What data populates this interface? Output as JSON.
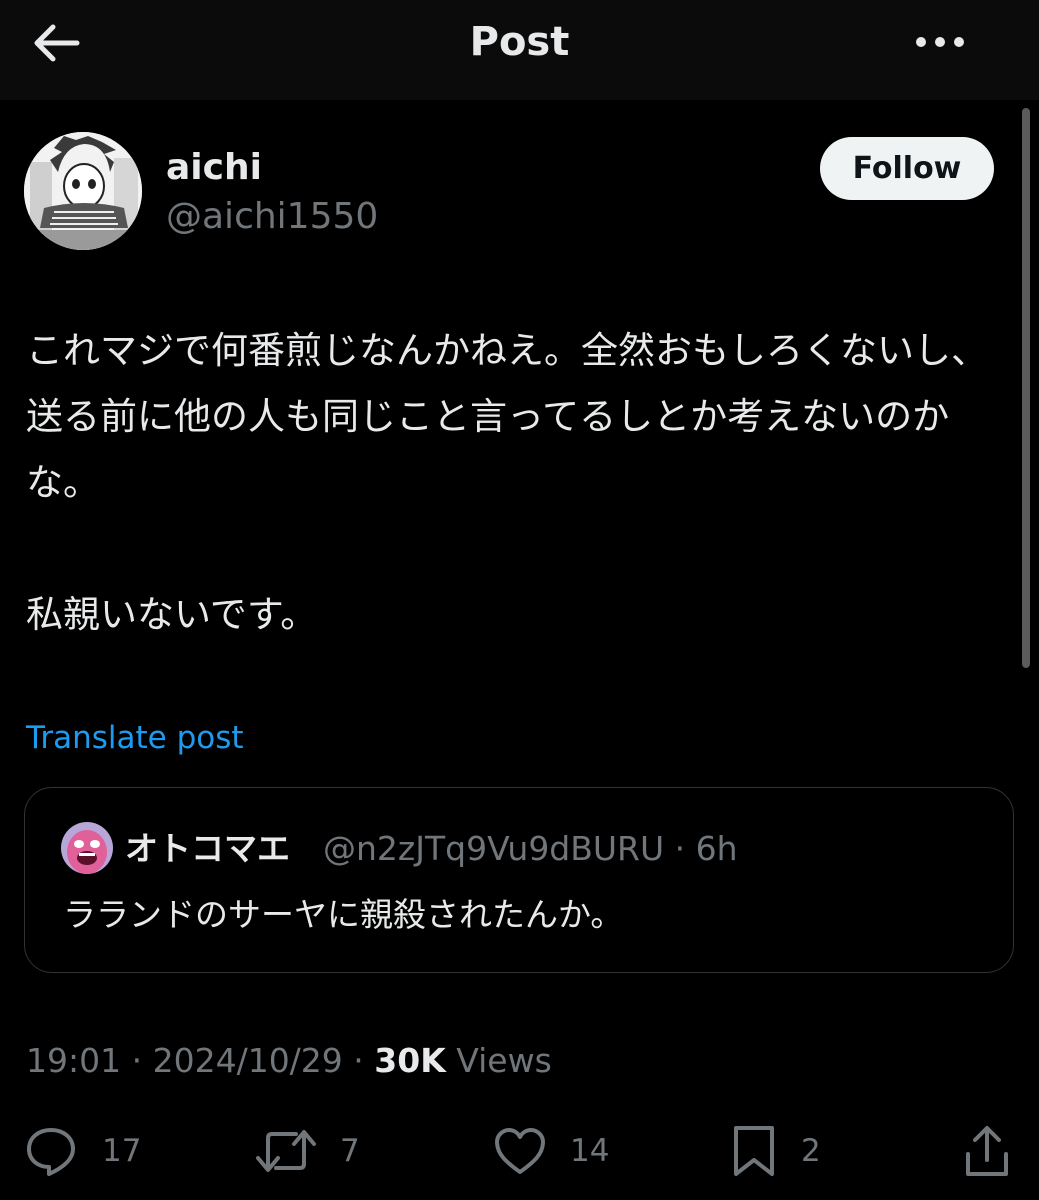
{
  "header": {
    "title": "Post"
  },
  "author": {
    "display_name": "aichi",
    "handle": "@aichi1550"
  },
  "follow_label": "Follow",
  "post": {
    "text": "これマジで何番煎じなんかねえ。全然おもしろくないし、送る前に他の人も同じこと言ってるしとか考えないのかな。\n\n私親いないです。",
    "translate_label": "Translate post"
  },
  "quote": {
    "display_name": "オトコマエ",
    "handle": "@n2zJTq9Vu9dBURU",
    "separator": " · ",
    "time": "6h",
    "text": "ラランドのサーヤに親殺されたんか。"
  },
  "meta": {
    "time": "19:01",
    "separator": " · ",
    "date": "2024/10/29",
    "views_count": "30K",
    "views_label": "Views"
  },
  "actions": {
    "replies": "17",
    "reposts": "7",
    "likes": "14",
    "bookmarks": "2"
  },
  "icons": {
    "back": "arrow-left-icon",
    "more": "more-horizontal-icon",
    "reply": "reply-icon",
    "repost": "repost-icon",
    "like": "heart-icon",
    "bookmark": "bookmark-icon",
    "share": "share-icon"
  },
  "colors": {
    "background": "#000000",
    "text_primary": "#e7e9ea",
    "text_secondary": "#71767b",
    "link": "#1d9bf0",
    "follow_bg": "#eff3f4",
    "border": "#2f3336"
  }
}
